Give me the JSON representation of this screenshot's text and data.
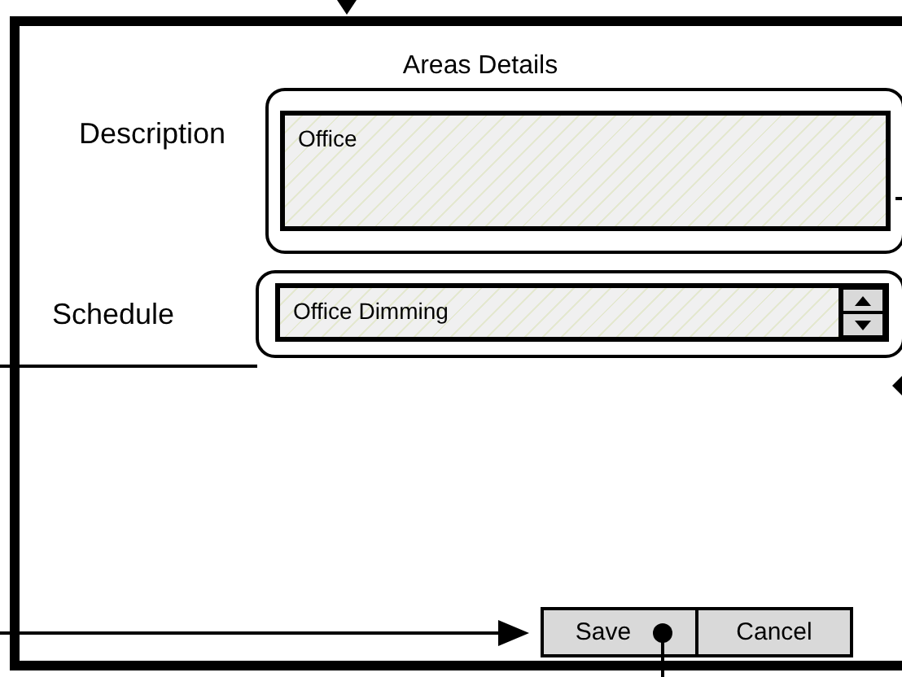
{
  "window": {
    "title": "Areas Details"
  },
  "fields": [
    {
      "kind": "text",
      "label": "Description",
      "value": "Office"
    },
    {
      "kind": "spinner",
      "label": "Schedule",
      "value": "Office Dimming"
    }
  ],
  "buttons": [
    {
      "label": "Save"
    },
    {
      "label": "Cancel"
    }
  ]
}
